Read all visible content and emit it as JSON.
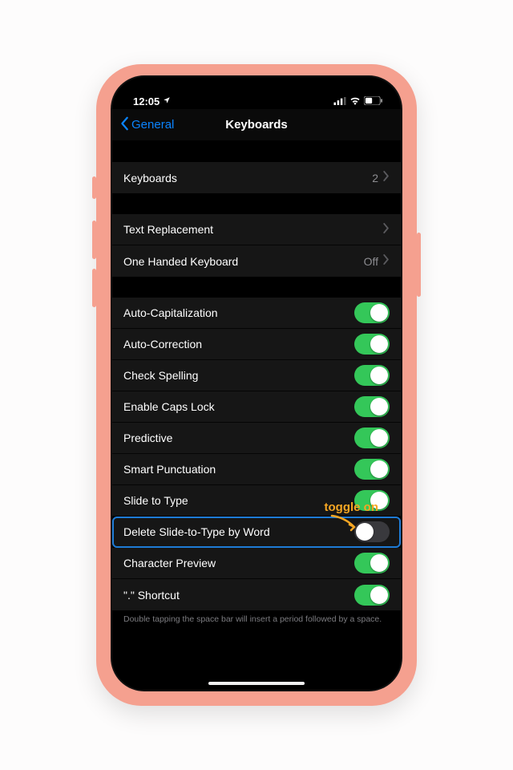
{
  "status": {
    "time": "12:05",
    "loc_glyph": "➤"
  },
  "nav": {
    "back": "General",
    "title": "Keyboards"
  },
  "groups": {
    "a": [
      {
        "label": "Keyboards",
        "value": "2",
        "chevron": true
      }
    ],
    "b": [
      {
        "label": "Text Replacement",
        "value": "",
        "chevron": true
      },
      {
        "label": "One Handed Keyboard",
        "value": "Off",
        "chevron": true
      }
    ],
    "c": [
      {
        "label": "Auto-Capitalization",
        "toggle": true,
        "on": true
      },
      {
        "label": "Auto-Correction",
        "toggle": true,
        "on": true
      },
      {
        "label": "Check Spelling",
        "toggle": true,
        "on": true
      },
      {
        "label": "Enable Caps Lock",
        "toggle": true,
        "on": true
      },
      {
        "label": "Predictive",
        "toggle": true,
        "on": true
      },
      {
        "label": "Smart Punctuation",
        "toggle": true,
        "on": true
      },
      {
        "label": "Slide to Type",
        "toggle": true,
        "on": true
      },
      {
        "label": "Delete Slide-to-Type by Word",
        "toggle": true,
        "on": false,
        "highlight": true
      },
      {
        "label": "Character Preview",
        "toggle": true,
        "on": true
      },
      {
        "label": "\".\" Shortcut",
        "toggle": true,
        "on": true
      }
    ]
  },
  "annotation": "toggle on",
  "footer": "Double tapping the space bar will insert a period followed by a space."
}
